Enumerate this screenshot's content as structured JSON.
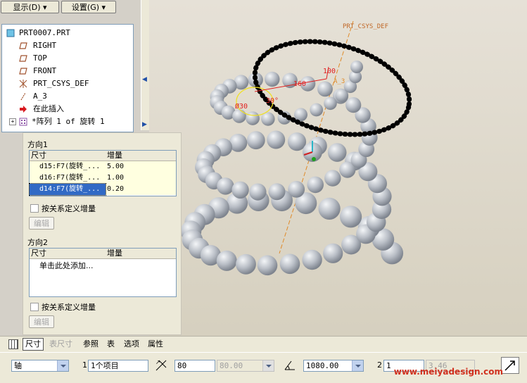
{
  "toolbar": {
    "display_label": "显示(D)",
    "settings_label": "设置(G)"
  },
  "tree": {
    "items": [
      {
        "label": "PRT0007.PRT",
        "icon": "part-icon"
      },
      {
        "label": "RIGHT",
        "icon": "datum-plane-icon"
      },
      {
        "label": "TOP",
        "icon": "datum-plane-icon"
      },
      {
        "label": "FRONT",
        "icon": "datum-plane-icon"
      },
      {
        "label": "PRT_CSYS_DEF",
        "icon": "csys-icon"
      },
      {
        "label": "A_3",
        "icon": "datum-axis-icon"
      },
      {
        "label": "在此插入",
        "icon": "insert-here-arrow-icon"
      },
      {
        "label": "*阵列 1 of 旋转 1",
        "icon": "pattern-icon"
      }
    ]
  },
  "viewport": {
    "csys_label": "PRT_CSYS_DEF",
    "dims": {
      "d160": "160",
      "d100": "100",
      "d30": "Ø30",
      "d30deg": "30°",
      "a3": "A_3"
    }
  },
  "panel": {
    "dir1_title": "方向1",
    "dir1_headers": {
      "dim": "尺寸",
      "inc": "增量"
    },
    "dir1_rows": [
      {
        "dim": "d15:F7(旋转_...",
        "inc": "5.00"
      },
      {
        "dim": "d16:F7(旋转_...",
        "inc": "1.00"
      },
      {
        "dim": "d14:F7(旋转_...",
        "inc": "0.20"
      }
    ],
    "dir1_checkbox": "按关系定义增量",
    "dir1_edit": "编辑",
    "dir2_title": "方向2",
    "dir2_headers": {
      "dim": "尺寸",
      "inc": "增量"
    },
    "dir2_placeholder": "单击此处添加...",
    "dir2_checkbox": "按关系定义增量",
    "dir2_edit": "编辑"
  },
  "tabs": {
    "dimensions": "尺寸",
    "table_dimensions": "表尺寸",
    "references": "参照",
    "table": "表",
    "options": "选项",
    "properties": "属性"
  },
  "bottombar": {
    "type_select": "轴",
    "dir1_index": "1",
    "dir1_items": "1个项目",
    "count_value": "80",
    "count_disabled": "80.00",
    "angle_value": "1080.00",
    "dir2_index": "2",
    "dir2_count": "1",
    "dir2_disabled": "3.46",
    "watermark": "www.meiyadesign.com"
  }
}
